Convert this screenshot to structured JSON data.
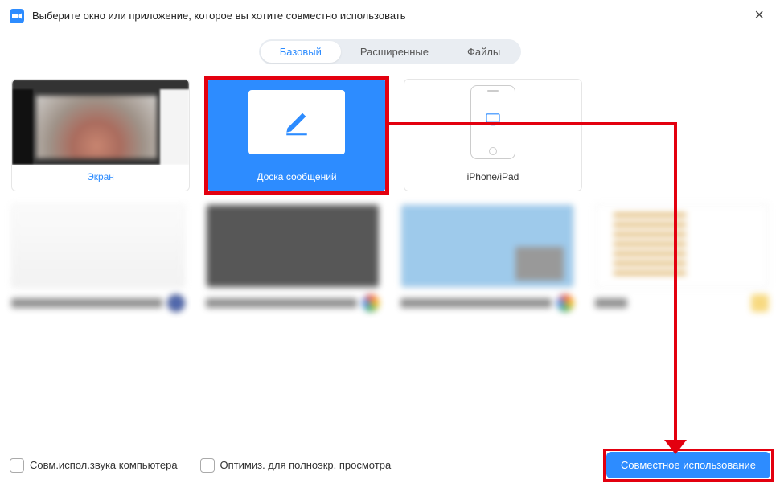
{
  "header": {
    "title": "Выберите окно или приложение, которое вы хотите совместно использовать",
    "close_label": "×"
  },
  "tabs": {
    "basic": "Базовый",
    "advanced": "Расширенные",
    "files": "Файлы"
  },
  "cards": {
    "screen": "Экран",
    "whiteboard": "Доска сообщений",
    "iphone": "iPhone/iPad"
  },
  "footer": {
    "share_audio": "Совм.испол.звука компьютера",
    "optimize_fullscreen": "Оптимиз. для полноэкр. просмотра",
    "share_button": "Совместное использование"
  },
  "colors": {
    "accent": "#2d8cff",
    "annotation": "#e3000f"
  }
}
